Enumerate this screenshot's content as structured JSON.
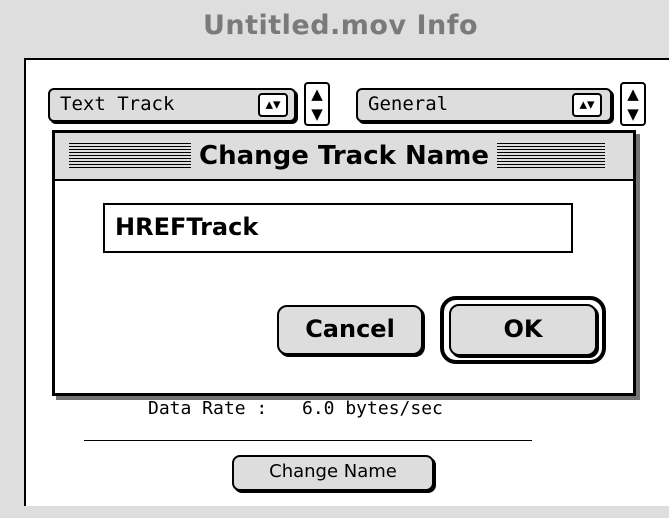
{
  "window": {
    "title": "Untitled.mov Info"
  },
  "track_popup": {
    "selected": "Text Track",
    "arrow": "▴▾"
  },
  "info_popup": {
    "selected": "General",
    "arrow": "▴▾"
  },
  "steppers": {
    "up": "▲",
    "down": "▼"
  },
  "dialog": {
    "title": "Change Track Name",
    "name_value": "HREFTrack",
    "cancel_label": "Cancel",
    "ok_label": "OK"
  },
  "info": {
    "data_rate_label": "Data Rate :",
    "data_rate_value": "6.0 bytes/sec"
  },
  "change_name_button": "Change Name",
  "colors": {
    "window_gray": "#dedede",
    "title_gray": "#7a7a7a",
    "button_gray": "#dddddd",
    "black": "#000000",
    "white": "#ffffff"
  }
}
